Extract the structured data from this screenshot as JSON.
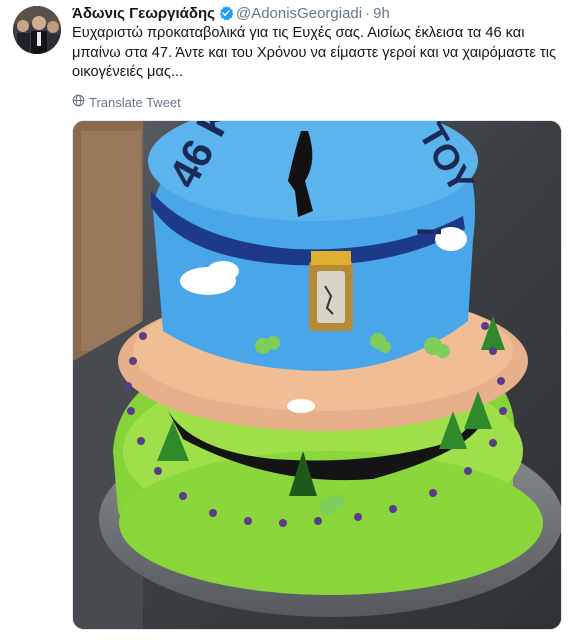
{
  "tweet": {
    "display_name": "Άδωνις Γεωργιάδης",
    "handle": "@AdonisGeorgiadi",
    "separator": "·",
    "time": "9h",
    "text": "Ευχαριστώ προκαταβολικά για τις Ευχές σας. Αισίως έκλεισα τα 46 και μπαίνω στα 47. Άντε και του Χρόνου να είμαστε γεροί και να χαιρόμαστε τις οικογένειές μας...",
    "translate_label": "Translate Tweet",
    "icons": {
      "verified": "verified-badge-icon",
      "translate": "globe-icon"
    },
    "colors": {
      "verified": "#1da1f2",
      "secondary_text": "#657786"
    }
  },
  "media": {
    "cake_text_left": "46 Κ",
    "cake_text_right": "ΤΟΥ",
    "cake_text_mark": "¡"
  }
}
